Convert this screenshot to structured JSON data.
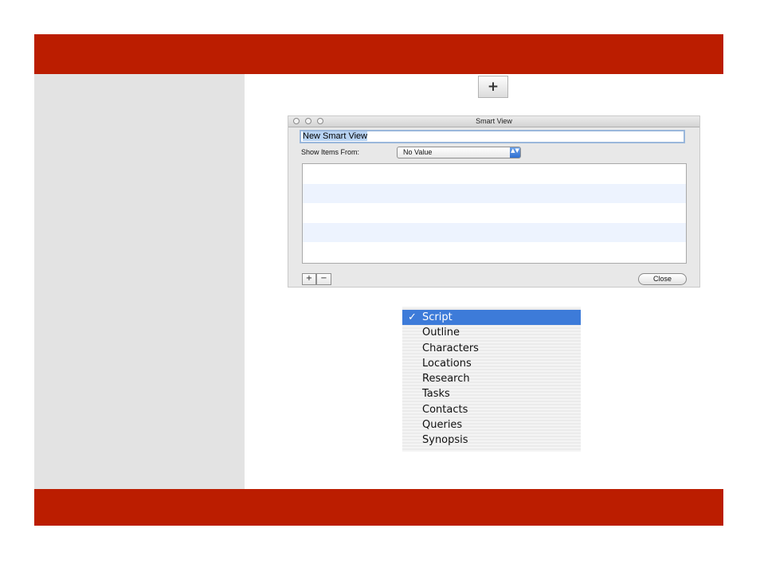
{
  "toolbar": {
    "add_label": "+"
  },
  "window": {
    "title": "Smart View",
    "name_value": "New Smart View",
    "show_items_label": "Show Items From:",
    "show_items_value": "No Value",
    "popup_arrows": "▲▼",
    "add_rule_label": "+",
    "remove_rule_label": "−",
    "close_label": "Close"
  },
  "menu": {
    "check": "✓",
    "items": [
      {
        "label": "Script",
        "selected": true
      },
      {
        "label": "Outline"
      },
      {
        "label": "Characters"
      },
      {
        "label": "Locations"
      },
      {
        "label": "Research"
      },
      {
        "label": "Tasks"
      },
      {
        "label": "Contacts"
      },
      {
        "label": "Queries"
      },
      {
        "label": "Synopsis"
      }
    ]
  },
  "colors": {
    "banner": "#bb1d00",
    "side_panel": "#e3e3e3",
    "menu_highlight": "#3d7bd9"
  }
}
